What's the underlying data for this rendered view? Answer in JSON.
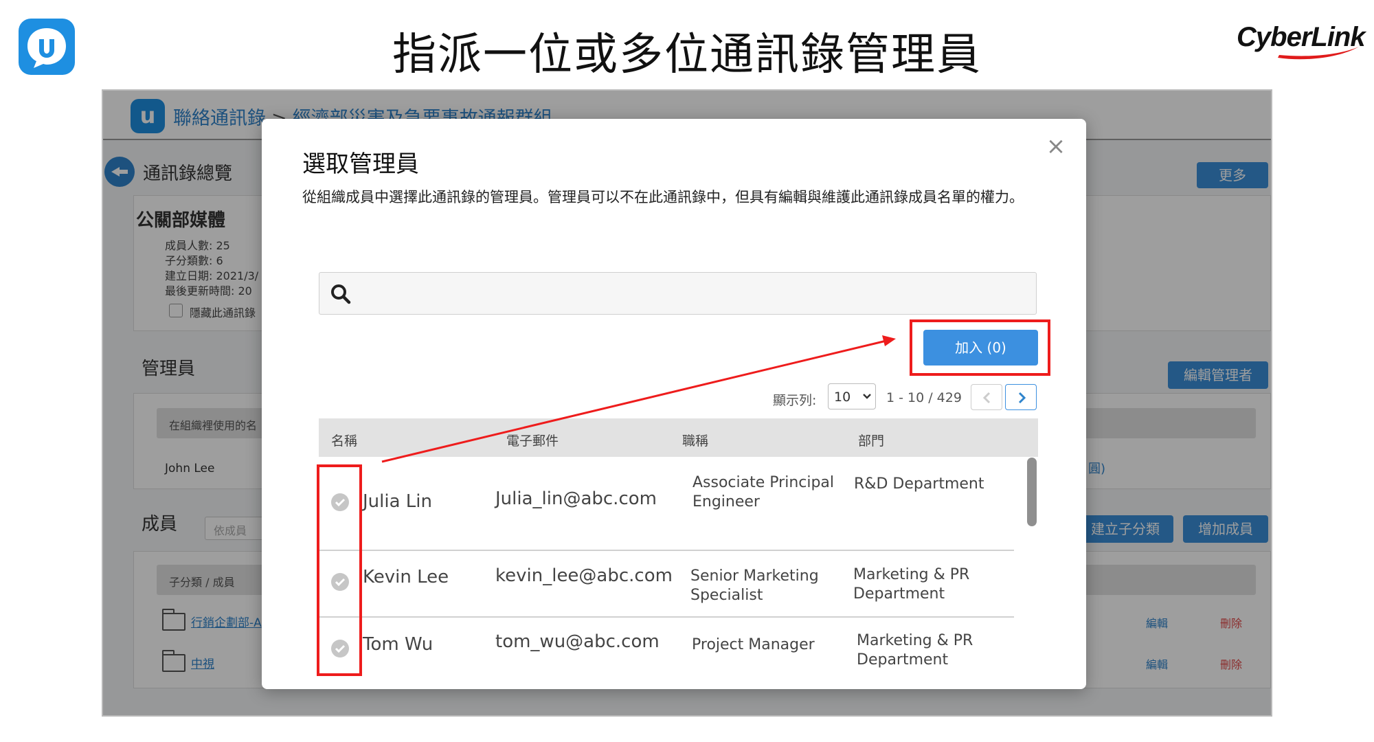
{
  "slide": {
    "title": "指派一位或多位通訊錄管理員",
    "brand": "CyberLink",
    "colors": {
      "accent": "#1e8fe1",
      "highlight": "#ee1c1c",
      "button": "#3c90e0"
    }
  },
  "app": {
    "breadcrumb_root": "聯絡通訊錄",
    "breadcrumb_separator": ">",
    "breadcrumb_current": "經濟部災害及急要事故通報群組",
    "overview_title": "通訊錄總覽",
    "more_label": "更多",
    "group_name": "公關部媒體",
    "meta": [
      "成員人數: 25",
      "子分類數: 6",
      "建立日期: 2021/3/",
      "最後更新時間: 20"
    ],
    "hide_label": "隱藏此通訊錄",
    "admin_section_title": "管理員",
    "edit_admin_label": "編輯管理者",
    "admin_table_header": "在組織裡使用的名",
    "admin_name": "John Lee",
    "admin_paren_fragment": "圓)",
    "members_section_title": "成員",
    "filter_placeholder": "依成員",
    "create_subcategory_label": "建立子分類",
    "add_member_label": "增加成員",
    "member_table_header": "子分類 / 成員",
    "folders": [
      {
        "label": "行銷企劃部-A",
        "edit": "編輯",
        "delete": "刪除"
      },
      {
        "label": "中視",
        "edit": "編輯",
        "delete": "刪除"
      }
    ]
  },
  "modal": {
    "close_glyph": "×",
    "title": "選取管理員",
    "description": "從組織成員中選擇此通訊錄的管理員。管理員可以不在此通訊錄中，但具有編輯與維護此通訊錄成員名單的權力。",
    "search": {
      "placeholder": "",
      "value": ""
    },
    "add_button_label": "加入 (0)",
    "page_size_label": "顯示列:",
    "page_size_value": "10",
    "page_range": "1 - 10 / 429",
    "columns": {
      "name": "名稱",
      "email": "電子郵件",
      "title": "職稱",
      "department": "部門"
    },
    "rows": [
      {
        "name": "Julia Lin",
        "email": "Julia_lin@abc.com",
        "title_line1": "Associate Principal",
        "title_line2": "Engineer",
        "dept_line1": "R&D Department",
        "dept_line2": ""
      },
      {
        "name": "Kevin Lee",
        "email": "kevin_lee@abc.com",
        "title_line1": "Senior Marketing",
        "title_line2": "Specialist",
        "dept_line1": "Marketing & PR",
        "dept_line2": "Department"
      },
      {
        "name": "Tom Wu",
        "email": "tom_wu@abc.com",
        "title_line1": "Project Manager",
        "title_line2": "",
        "dept_line1": "Marketing & PR",
        "dept_line2": "Department"
      }
    ]
  }
}
